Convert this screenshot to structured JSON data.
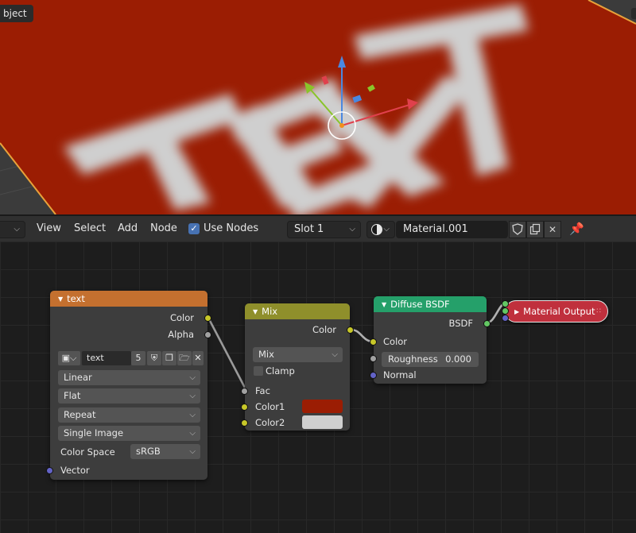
{
  "viewport": {
    "mode_label": "bject",
    "scene_text": "TEXT"
  },
  "header": {
    "menus": [
      "View",
      "Select",
      "Add",
      "Node"
    ],
    "use_nodes_label": "Use Nodes",
    "use_nodes_checked": true,
    "slot": "Slot 1",
    "material_name": "Material.001"
  },
  "nodes": {
    "image_texture": {
      "title": "text",
      "header_color": "#c4702f",
      "outputs": [
        "Color",
        "Alpha"
      ],
      "image_name": "text",
      "user_count": "5",
      "interpolation": "Linear",
      "projection": "Flat",
      "extension": "Repeat",
      "source": "Single Image",
      "color_space_label": "Color Space",
      "color_space": "sRGB",
      "input": "Vector"
    },
    "mix": {
      "title": "Mix",
      "header_color": "#8f8f2b",
      "output": "Color",
      "blend_type": "Mix",
      "clamp_label": "Clamp",
      "fac": "Fac",
      "color1": "Color1",
      "color2": "Color2",
      "color1_value": "#9b1d03",
      "color2_value": "#cfcfcf"
    },
    "diffuse": {
      "title": "Diffuse BSDF",
      "header_color": "#25a06a",
      "output": "BSDF",
      "color": "Color",
      "roughness_label": "Roughness",
      "roughness_value": "0.000",
      "normal": "Normal"
    },
    "material_output": {
      "title": "Material Output",
      "header_color": "#c0303d"
    }
  }
}
